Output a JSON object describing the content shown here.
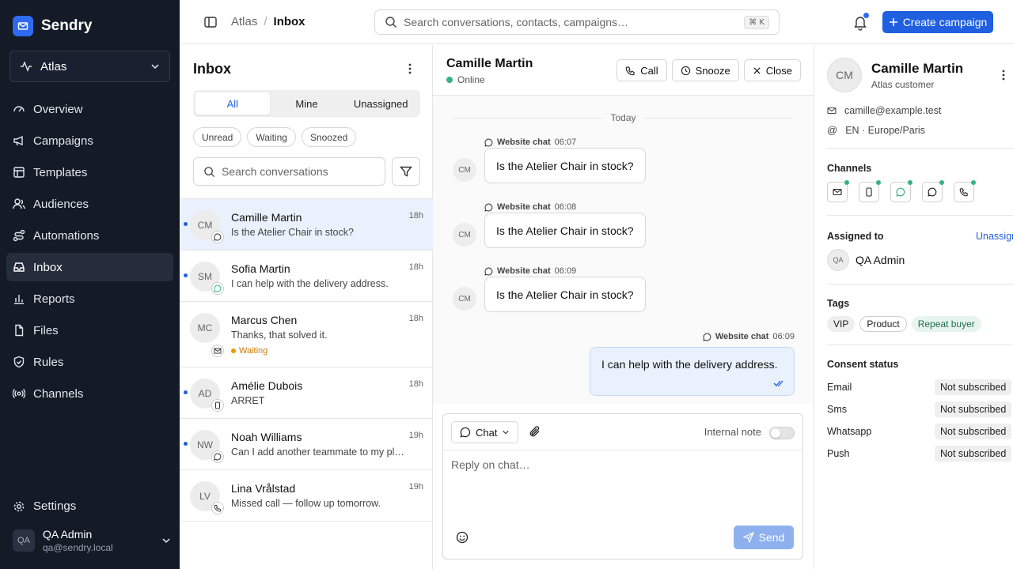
{
  "brand": {
    "name": "Sendry"
  },
  "workspace": {
    "name": "Atlas"
  },
  "nav": [
    {
      "id": "overview",
      "label": "Overview",
      "icon": "gauge-icon"
    },
    {
      "id": "campaigns",
      "label": "Campaigns",
      "icon": "megaphone-icon"
    },
    {
      "id": "templates",
      "label": "Templates",
      "icon": "layout-icon"
    },
    {
      "id": "audiences",
      "label": "Audiences",
      "icon": "users-icon"
    },
    {
      "id": "automations",
      "label": "Automations",
      "icon": "route-icon"
    },
    {
      "id": "inbox",
      "label": "Inbox",
      "icon": "inbox-icon",
      "active": true
    },
    {
      "id": "reports",
      "label": "Reports",
      "icon": "bar-chart-icon"
    },
    {
      "id": "files",
      "label": "Files",
      "icon": "file-icon"
    },
    {
      "id": "rules",
      "label": "Rules",
      "icon": "shield-icon"
    },
    {
      "id": "channels",
      "label": "Channels",
      "icon": "radio-icon"
    }
  ],
  "settings": {
    "label": "Settings"
  },
  "user": {
    "initials": "QA",
    "name": "QA Admin",
    "email": "qa@sendry.local"
  },
  "breadcrumb": {
    "root": "Atlas",
    "sep": "/",
    "current": "Inbox"
  },
  "search": {
    "placeholder": "Search conversations, contacts, campaigns…",
    "shortcut": "⌘ K"
  },
  "create_button": {
    "label": "Create campaign"
  },
  "inbox": {
    "title": "Inbox",
    "tabs": [
      "All",
      "Mine",
      "Unassigned"
    ],
    "chips": [
      "Unread",
      "Waiting",
      "Snoozed"
    ],
    "search_placeholder": "Search conversations",
    "conversations": [
      {
        "initials": "CM",
        "name": "Camille Martin",
        "preview": "Is the Atelier Chair in stock?",
        "time": "18h",
        "unread": true,
        "active": true,
        "channel": "chat-icon"
      },
      {
        "initials": "SM",
        "name": "Sofia Martin",
        "preview": "I can help with the delivery address.",
        "time": "18h",
        "unread": true,
        "channel": "whatsapp-icon"
      },
      {
        "initials": "MC",
        "name": "Marcus Chen",
        "preview": "Thanks, that solved it.",
        "time": "18h",
        "unread": false,
        "status": "Waiting",
        "channel": "mail-icon"
      },
      {
        "initials": "AD",
        "name": "Amélie Dubois",
        "preview": "ARRET",
        "time": "18h",
        "unread": true,
        "channel": "sms-icon"
      },
      {
        "initials": "NW",
        "name": "Noah Williams",
        "preview": "Can I add another teammate to my pl…",
        "time": "19h",
        "unread": true,
        "channel": "chat-icon"
      },
      {
        "initials": "LV",
        "name": "Lina Vrålstad",
        "preview": "Missed call — follow up tomorrow.",
        "time": "19h",
        "unread": false,
        "channel": "phone-icon"
      }
    ]
  },
  "thread": {
    "name": "Camille Martin",
    "presence": "Online",
    "actions": {
      "call": "Call",
      "snooze": "Snooze",
      "close": "Close"
    },
    "day": "Today",
    "messages": [
      {
        "initials": "CM",
        "source": "Website chat",
        "time": "06:07",
        "text": "Is the Atelier Chair in stock?"
      },
      {
        "initials": "CM",
        "source": "Website chat",
        "time": "06:08",
        "text": "Is the Atelier Chair in stock?"
      },
      {
        "initials": "CM",
        "source": "Website chat",
        "time": "06:09",
        "text": "Is the Atelier Chair in stock?"
      }
    ],
    "outgoing": {
      "source": "Website chat",
      "time": "06:09",
      "text": "I can help with the delivery address."
    },
    "composer": {
      "channel": "Chat",
      "note_label": "Internal note",
      "placeholder": "Reply on chat…",
      "send": "Send"
    }
  },
  "contact": {
    "initials": "CM",
    "name": "Camille Martin",
    "subtitle": "Atlas customer",
    "email": "camille@example.test",
    "locale": "EN · Europe/Paris",
    "channels_label": "Channels",
    "channel_icons": [
      "mail-icon",
      "sms-icon",
      "whatsapp-icon",
      "chat-icon",
      "phone-icon"
    ],
    "assigned_label": "Assigned to",
    "unassign": "Unassign",
    "assignee": {
      "initials": "QA",
      "name": "QA Admin"
    },
    "tags_label": "Tags",
    "tags": [
      "VIP",
      "Product",
      "Repeat buyer"
    ],
    "consent_label": "Consent status",
    "consent": [
      {
        "channel": "Email",
        "status": "Not subscribed"
      },
      {
        "channel": "Sms",
        "status": "Not subscribed"
      },
      {
        "channel": "Whatsapp",
        "status": "Not subscribed"
      },
      {
        "channel": "Push",
        "status": "Not subscribed"
      }
    ]
  },
  "colors": {
    "accent": "#1f5fe0",
    "sidebar": "#141a26",
    "online": "#36b37e",
    "waiting": "#e89a00"
  }
}
